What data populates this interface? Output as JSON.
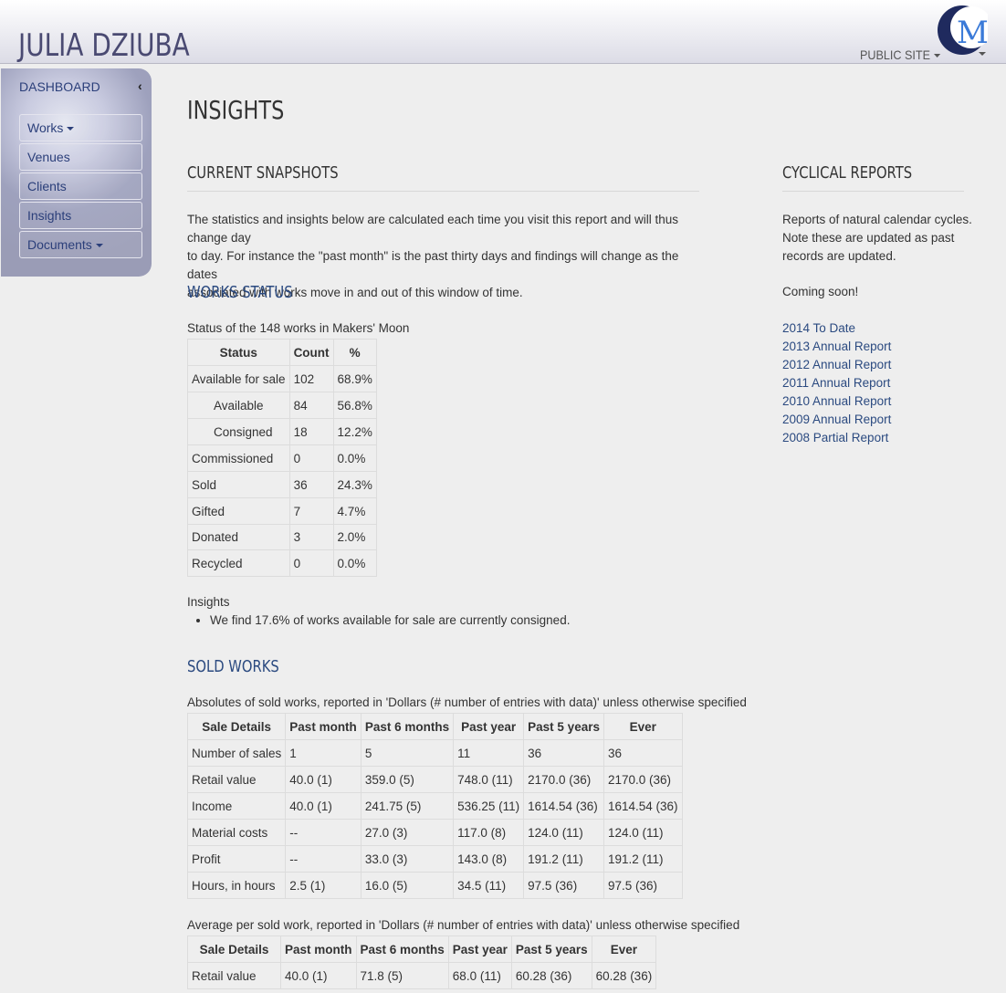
{
  "header": {
    "site_title": "JULIA DZIUBA",
    "public_site_label": "PUBLIC SITE",
    "logo_icon": "makers-moon-logo-icon"
  },
  "sidebar": {
    "dashboard_label": "DASHBOARD",
    "collapse_icon": "chevron-left-icon",
    "items": [
      {
        "label": "Works",
        "has_dropdown": true
      },
      {
        "label": "Venues",
        "has_dropdown": false
      },
      {
        "label": "Clients",
        "has_dropdown": false
      },
      {
        "label": "Insights",
        "has_dropdown": false
      },
      {
        "label": "Documents",
        "has_dropdown": true
      }
    ]
  },
  "page": {
    "title": "INSIGHTS",
    "current_snapshots": {
      "heading": "CURRENT SNAPSHOTS",
      "intro_line1": "The statistics and insights below are calculated each time you visit this report and will thus change day",
      "intro_line2": "to day. For instance the \"past month\" is the past thirty days and findings will change as the dates",
      "intro_line3": "associated with works move in and out of this window of time."
    },
    "works_status": {
      "heading": "WORKS STATUS",
      "caption": "Status of the 148 works in Makers' Moon",
      "headers": [
        "Status",
        "Count",
        "%"
      ],
      "rows": [
        [
          "Available for sale",
          "102",
          "68.9%"
        ],
        [
          "Available",
          "84",
          "56.8%"
        ],
        [
          "Consigned",
          "18",
          "12.2%"
        ],
        [
          "Commissioned",
          "0",
          "0.0%"
        ],
        [
          "Sold",
          "36",
          "24.3%"
        ],
        [
          "Gifted",
          "7",
          "4.7%"
        ],
        [
          "Donated",
          "3",
          "2.0%"
        ],
        [
          "Recycled",
          "0",
          "0.0%"
        ]
      ],
      "insights_label": "Insights",
      "insights": [
        "We find 17.6% of works available for sale are currently consigned."
      ]
    },
    "sold_works": {
      "heading": "SOLD WORKS",
      "absolutes_caption": "Absolutes of sold works, reported in 'Dollars (# number of entries with data)' unless otherwise specified",
      "headers": [
        "Sale Details",
        "Past month",
        "Past 6 months",
        "Past year",
        "Past 5 years",
        "Ever"
      ],
      "absolutes_rows": [
        [
          "Number of sales",
          "1",
          "5",
          "11",
          "36",
          "36"
        ],
        [
          "Retail value",
          "40.0 (1)",
          "359.0 (5)",
          "748.0 (11)",
          "2170.0 (36)",
          "2170.0 (36)"
        ],
        [
          "Income",
          "40.0 (1)",
          "241.75 (5)",
          "536.25 (11)",
          "1614.54 (36)",
          "1614.54 (36)"
        ],
        [
          "Material costs",
          "--",
          "27.0 (3)",
          "117.0 (8)",
          "124.0 (11)",
          "124.0 (11)"
        ],
        [
          "Profit",
          "--",
          "33.0 (3)",
          "143.0 (8)",
          "191.2 (11)",
          "191.2 (11)"
        ],
        [
          "Hours, in hours",
          "2.5 (1)",
          "16.0 (5)",
          "34.5 (11)",
          "97.5 (36)",
          "97.5 (36)"
        ]
      ],
      "average_caption": "Average per sold work, reported in 'Dollars (# number of entries with data)' unless otherwise specified",
      "average_rows": [
        [
          "Retail value",
          "40.0 (1)",
          "71.8 (5)",
          "68.0 (11)",
          "60.28 (36)",
          "60.28 (36)"
        ]
      ]
    },
    "cyclical_reports": {
      "heading": "CYCLICAL REPORTS",
      "line1": "Reports of natural calendar cycles.",
      "line2": "Note these are updated as past",
      "line3": "records are updated.",
      "coming_soon": "Coming soon!",
      "links": [
        "2014 To Date",
        "2013 Annual Report",
        "2012 Annual Report",
        "2011 Annual Report",
        "2010 Annual Report",
        "2009 Annual Report",
        "2008 Partial Report"
      ]
    }
  },
  "colors": {
    "link": "#2b4a80",
    "title": "#4a4a72",
    "background": "#eeeeee"
  }
}
